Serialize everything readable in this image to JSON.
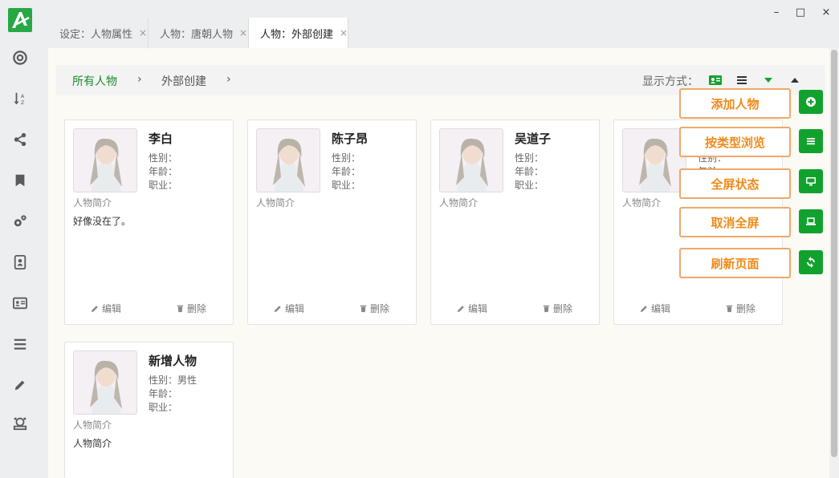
{
  "tabs": [
    {
      "label": "设定：人物属性",
      "close": "×"
    },
    {
      "label": "人物：唐朝人物",
      "close": "×"
    },
    {
      "label": "人物：外部创建",
      "close": "×"
    }
  ],
  "window_controls": {
    "minimize": "–",
    "maximize": "□",
    "close": "×"
  },
  "breadcrumb": {
    "root": "所有人物",
    "sep": "›",
    "current": "外部创建"
  },
  "display": {
    "label": "显示方式："
  },
  "cards": [
    {
      "name": "李白",
      "gender": "性别：",
      "age": "年龄：",
      "job": "职业：",
      "intro_label": "人物简介",
      "intro": "好像没在了。",
      "edit": "编辑",
      "delete": "删除"
    },
    {
      "name": "陈子昂",
      "gender": "性别：",
      "age": "年龄：",
      "job": "职业：",
      "intro_label": "人物简介",
      "intro": "",
      "edit": "编辑",
      "delete": "删除"
    },
    {
      "name": "吴道子",
      "gender": "性别：",
      "age": "年龄：",
      "job": "职业：",
      "intro_label": "人物简介",
      "intro": "",
      "edit": "编辑",
      "delete": "删除"
    },
    {
      "name": "",
      "gender": "性别：",
      "age": "年龄：",
      "job": "",
      "intro_label": "人物简介",
      "intro": "",
      "edit": "编辑",
      "delete": "删除"
    },
    {
      "name": "新增人物",
      "gender": "性别：男性",
      "age": "年龄：",
      "job": "职业：",
      "intro_label": "人物简介",
      "intro": "人物简介",
      "edit": "",
      "delete": ""
    }
  ],
  "tools": [
    {
      "callout": "添加人物",
      "icon": "plus-circle-icon"
    },
    {
      "callout": "按类型浏览",
      "icon": "list-icon"
    },
    {
      "callout": "全屏状态",
      "icon": "monitor-icon"
    },
    {
      "callout": "取消全屏",
      "icon": "laptop-icon"
    },
    {
      "callout": "刷新页面",
      "icon": "refresh-icon"
    }
  ],
  "colors": {
    "accent": "#11a22e",
    "callout_border": "#f0a868",
    "callout_text": "#f08a1a",
    "breadcrumb_root": "#1a8c2e"
  }
}
